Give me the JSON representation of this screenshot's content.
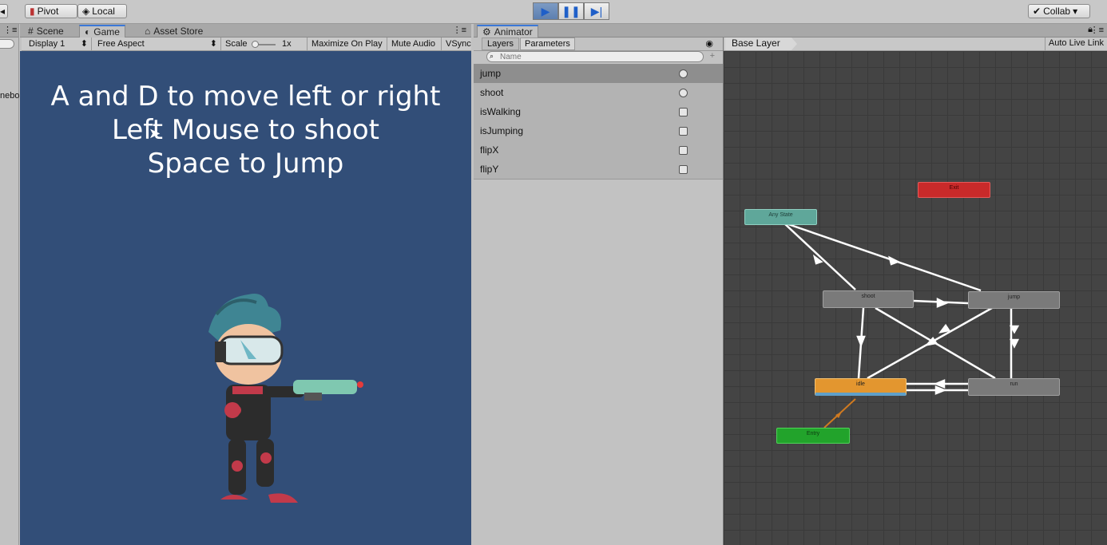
{
  "toolbar": {
    "pivot_label": "Pivot",
    "local_label": "Local",
    "collab_label": "Collab"
  },
  "left_panel": {
    "truncated_text": "nebo"
  },
  "game_panel": {
    "tabs": [
      {
        "label": "Scene",
        "icon": "hash-icon"
      },
      {
        "label": "Game",
        "icon": "pacman-icon"
      },
      {
        "label": "Asset Store",
        "icon": "store-icon"
      }
    ],
    "display": "Display 1",
    "aspect": "Free Aspect",
    "scale_label": "Scale",
    "scale_value": "1x",
    "maximize": "Maximize On Play",
    "mute": "Mute Audio",
    "vsync": "VSync",
    "instructions": [
      "A and D to move left or right",
      "Left Mouse to shoot",
      "Space to Jump"
    ]
  },
  "animator": {
    "tab_label": "Animator",
    "subtabs": [
      "Layers",
      "Parameters"
    ],
    "search_placeholder": "Name",
    "parameters": [
      {
        "name": "jump",
        "type": "trigger"
      },
      {
        "name": "shoot",
        "type": "trigger"
      },
      {
        "name": "isWalking",
        "type": "bool"
      },
      {
        "name": "isJumping",
        "type": "bool"
      },
      {
        "name": "flipX",
        "type": "bool"
      },
      {
        "name": "flipY",
        "type": "bool"
      }
    ],
    "breadcrumb": "Base Layer",
    "auto_live_link": "Auto Live Link",
    "nodes": {
      "exit": "Exit",
      "any_state": "Any State",
      "shoot": "shoot",
      "jump": "jump",
      "idle": "idle",
      "run": "run",
      "entry": "Entry"
    }
  },
  "colors": {
    "game_bg": "#324e78",
    "exit": "#c92a2a",
    "any_state": "#5fa79a",
    "idle": "#e3962f",
    "entry": "#22a32b",
    "state": "#7a7a7a"
  }
}
